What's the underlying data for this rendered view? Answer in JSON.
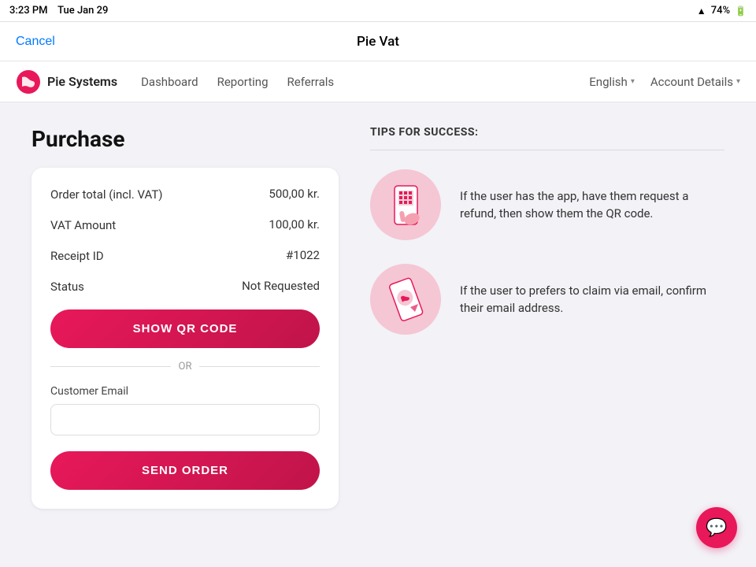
{
  "statusBar": {
    "time": "3:23 PM",
    "date": "Tue Jan 29",
    "battery": "74%"
  },
  "actionBar": {
    "cancelLabel": "Cancel",
    "title": "Pie Vat"
  },
  "navbar": {
    "brandName": "Pie Systems",
    "links": [
      {
        "label": "Dashboard"
      },
      {
        "label": "Reporting"
      },
      {
        "label": "Referrals"
      }
    ],
    "rightLinks": [
      {
        "label": "English",
        "hasDropdown": true
      },
      {
        "label": "Account Details",
        "hasDropdown": true
      }
    ]
  },
  "page": {
    "title": "Purchase"
  },
  "purchaseCard": {
    "orderTotalLabel": "Order total (incl. VAT)",
    "orderTotalValue": "500,00 kr.",
    "vatLabel": "VAT Amount",
    "vatValue": "100,00 kr.",
    "receiptIdLabel": "Receipt ID",
    "receiptIdValue": "#1022",
    "statusLabel": "Status",
    "statusValue": "Not Requested",
    "showQrLabel": "SHOW QR CODE",
    "orLabel": "OR",
    "emailLabel": "Customer Email",
    "emailPlaceholder": "",
    "sendOrderLabel": "SEND ORDER"
  },
  "tips": {
    "title": "TIPS FOR SUCCESS:",
    "items": [
      {
        "text": "If the user has the app, have them request a refund, then show them the QR code."
      },
      {
        "text": "If the user to prefers to claim via email, confirm their email address."
      }
    ]
  },
  "chatBubble": {
    "icon": "💬"
  }
}
